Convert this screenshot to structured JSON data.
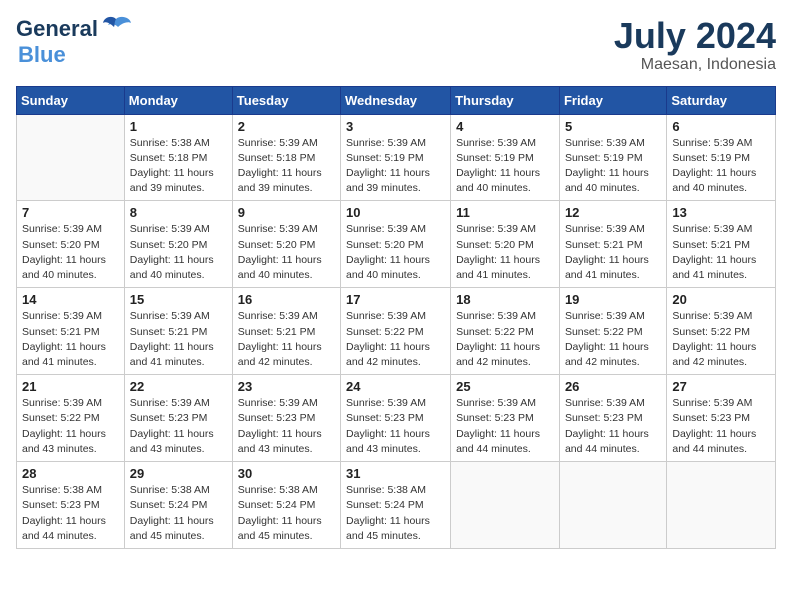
{
  "header": {
    "logo_line1": "General",
    "logo_line2": "Blue",
    "month": "July 2024",
    "location": "Maesan, Indonesia"
  },
  "weekdays": [
    "Sunday",
    "Monday",
    "Tuesday",
    "Wednesday",
    "Thursday",
    "Friday",
    "Saturday"
  ],
  "weeks": [
    [
      {
        "day": "",
        "info": ""
      },
      {
        "day": "1",
        "info": "Sunrise: 5:38 AM\nSunset: 5:18 PM\nDaylight: 11 hours\nand 39 minutes."
      },
      {
        "day": "2",
        "info": "Sunrise: 5:39 AM\nSunset: 5:18 PM\nDaylight: 11 hours\nand 39 minutes."
      },
      {
        "day": "3",
        "info": "Sunrise: 5:39 AM\nSunset: 5:19 PM\nDaylight: 11 hours\nand 39 minutes."
      },
      {
        "day": "4",
        "info": "Sunrise: 5:39 AM\nSunset: 5:19 PM\nDaylight: 11 hours\nand 40 minutes."
      },
      {
        "day": "5",
        "info": "Sunrise: 5:39 AM\nSunset: 5:19 PM\nDaylight: 11 hours\nand 40 minutes."
      },
      {
        "day": "6",
        "info": "Sunrise: 5:39 AM\nSunset: 5:19 PM\nDaylight: 11 hours\nand 40 minutes."
      }
    ],
    [
      {
        "day": "7",
        "info": "Sunrise: 5:39 AM\nSunset: 5:20 PM\nDaylight: 11 hours\nand 40 minutes."
      },
      {
        "day": "8",
        "info": "Sunrise: 5:39 AM\nSunset: 5:20 PM\nDaylight: 11 hours\nand 40 minutes."
      },
      {
        "day": "9",
        "info": "Sunrise: 5:39 AM\nSunset: 5:20 PM\nDaylight: 11 hours\nand 40 minutes."
      },
      {
        "day": "10",
        "info": "Sunrise: 5:39 AM\nSunset: 5:20 PM\nDaylight: 11 hours\nand 40 minutes."
      },
      {
        "day": "11",
        "info": "Sunrise: 5:39 AM\nSunset: 5:20 PM\nDaylight: 11 hours\nand 41 minutes."
      },
      {
        "day": "12",
        "info": "Sunrise: 5:39 AM\nSunset: 5:21 PM\nDaylight: 11 hours\nand 41 minutes."
      },
      {
        "day": "13",
        "info": "Sunrise: 5:39 AM\nSunset: 5:21 PM\nDaylight: 11 hours\nand 41 minutes."
      }
    ],
    [
      {
        "day": "14",
        "info": "Sunrise: 5:39 AM\nSunset: 5:21 PM\nDaylight: 11 hours\nand 41 minutes."
      },
      {
        "day": "15",
        "info": "Sunrise: 5:39 AM\nSunset: 5:21 PM\nDaylight: 11 hours\nand 41 minutes."
      },
      {
        "day": "16",
        "info": "Sunrise: 5:39 AM\nSunset: 5:21 PM\nDaylight: 11 hours\nand 42 minutes."
      },
      {
        "day": "17",
        "info": "Sunrise: 5:39 AM\nSunset: 5:22 PM\nDaylight: 11 hours\nand 42 minutes."
      },
      {
        "day": "18",
        "info": "Sunrise: 5:39 AM\nSunset: 5:22 PM\nDaylight: 11 hours\nand 42 minutes."
      },
      {
        "day": "19",
        "info": "Sunrise: 5:39 AM\nSunset: 5:22 PM\nDaylight: 11 hours\nand 42 minutes."
      },
      {
        "day": "20",
        "info": "Sunrise: 5:39 AM\nSunset: 5:22 PM\nDaylight: 11 hours\nand 42 minutes."
      }
    ],
    [
      {
        "day": "21",
        "info": "Sunrise: 5:39 AM\nSunset: 5:22 PM\nDaylight: 11 hours\nand 43 minutes."
      },
      {
        "day": "22",
        "info": "Sunrise: 5:39 AM\nSunset: 5:23 PM\nDaylight: 11 hours\nand 43 minutes."
      },
      {
        "day": "23",
        "info": "Sunrise: 5:39 AM\nSunset: 5:23 PM\nDaylight: 11 hours\nand 43 minutes."
      },
      {
        "day": "24",
        "info": "Sunrise: 5:39 AM\nSunset: 5:23 PM\nDaylight: 11 hours\nand 43 minutes."
      },
      {
        "day": "25",
        "info": "Sunrise: 5:39 AM\nSunset: 5:23 PM\nDaylight: 11 hours\nand 44 minutes."
      },
      {
        "day": "26",
        "info": "Sunrise: 5:39 AM\nSunset: 5:23 PM\nDaylight: 11 hours\nand 44 minutes."
      },
      {
        "day": "27",
        "info": "Sunrise: 5:39 AM\nSunset: 5:23 PM\nDaylight: 11 hours\nand 44 minutes."
      }
    ],
    [
      {
        "day": "28",
        "info": "Sunrise: 5:38 AM\nSunset: 5:23 PM\nDaylight: 11 hours\nand 44 minutes."
      },
      {
        "day": "29",
        "info": "Sunrise: 5:38 AM\nSunset: 5:24 PM\nDaylight: 11 hours\nand 45 minutes."
      },
      {
        "day": "30",
        "info": "Sunrise: 5:38 AM\nSunset: 5:24 PM\nDaylight: 11 hours\nand 45 minutes."
      },
      {
        "day": "31",
        "info": "Sunrise: 5:38 AM\nSunset: 5:24 PM\nDaylight: 11 hours\nand 45 minutes."
      },
      {
        "day": "",
        "info": ""
      },
      {
        "day": "",
        "info": ""
      },
      {
        "day": "",
        "info": ""
      }
    ]
  ]
}
